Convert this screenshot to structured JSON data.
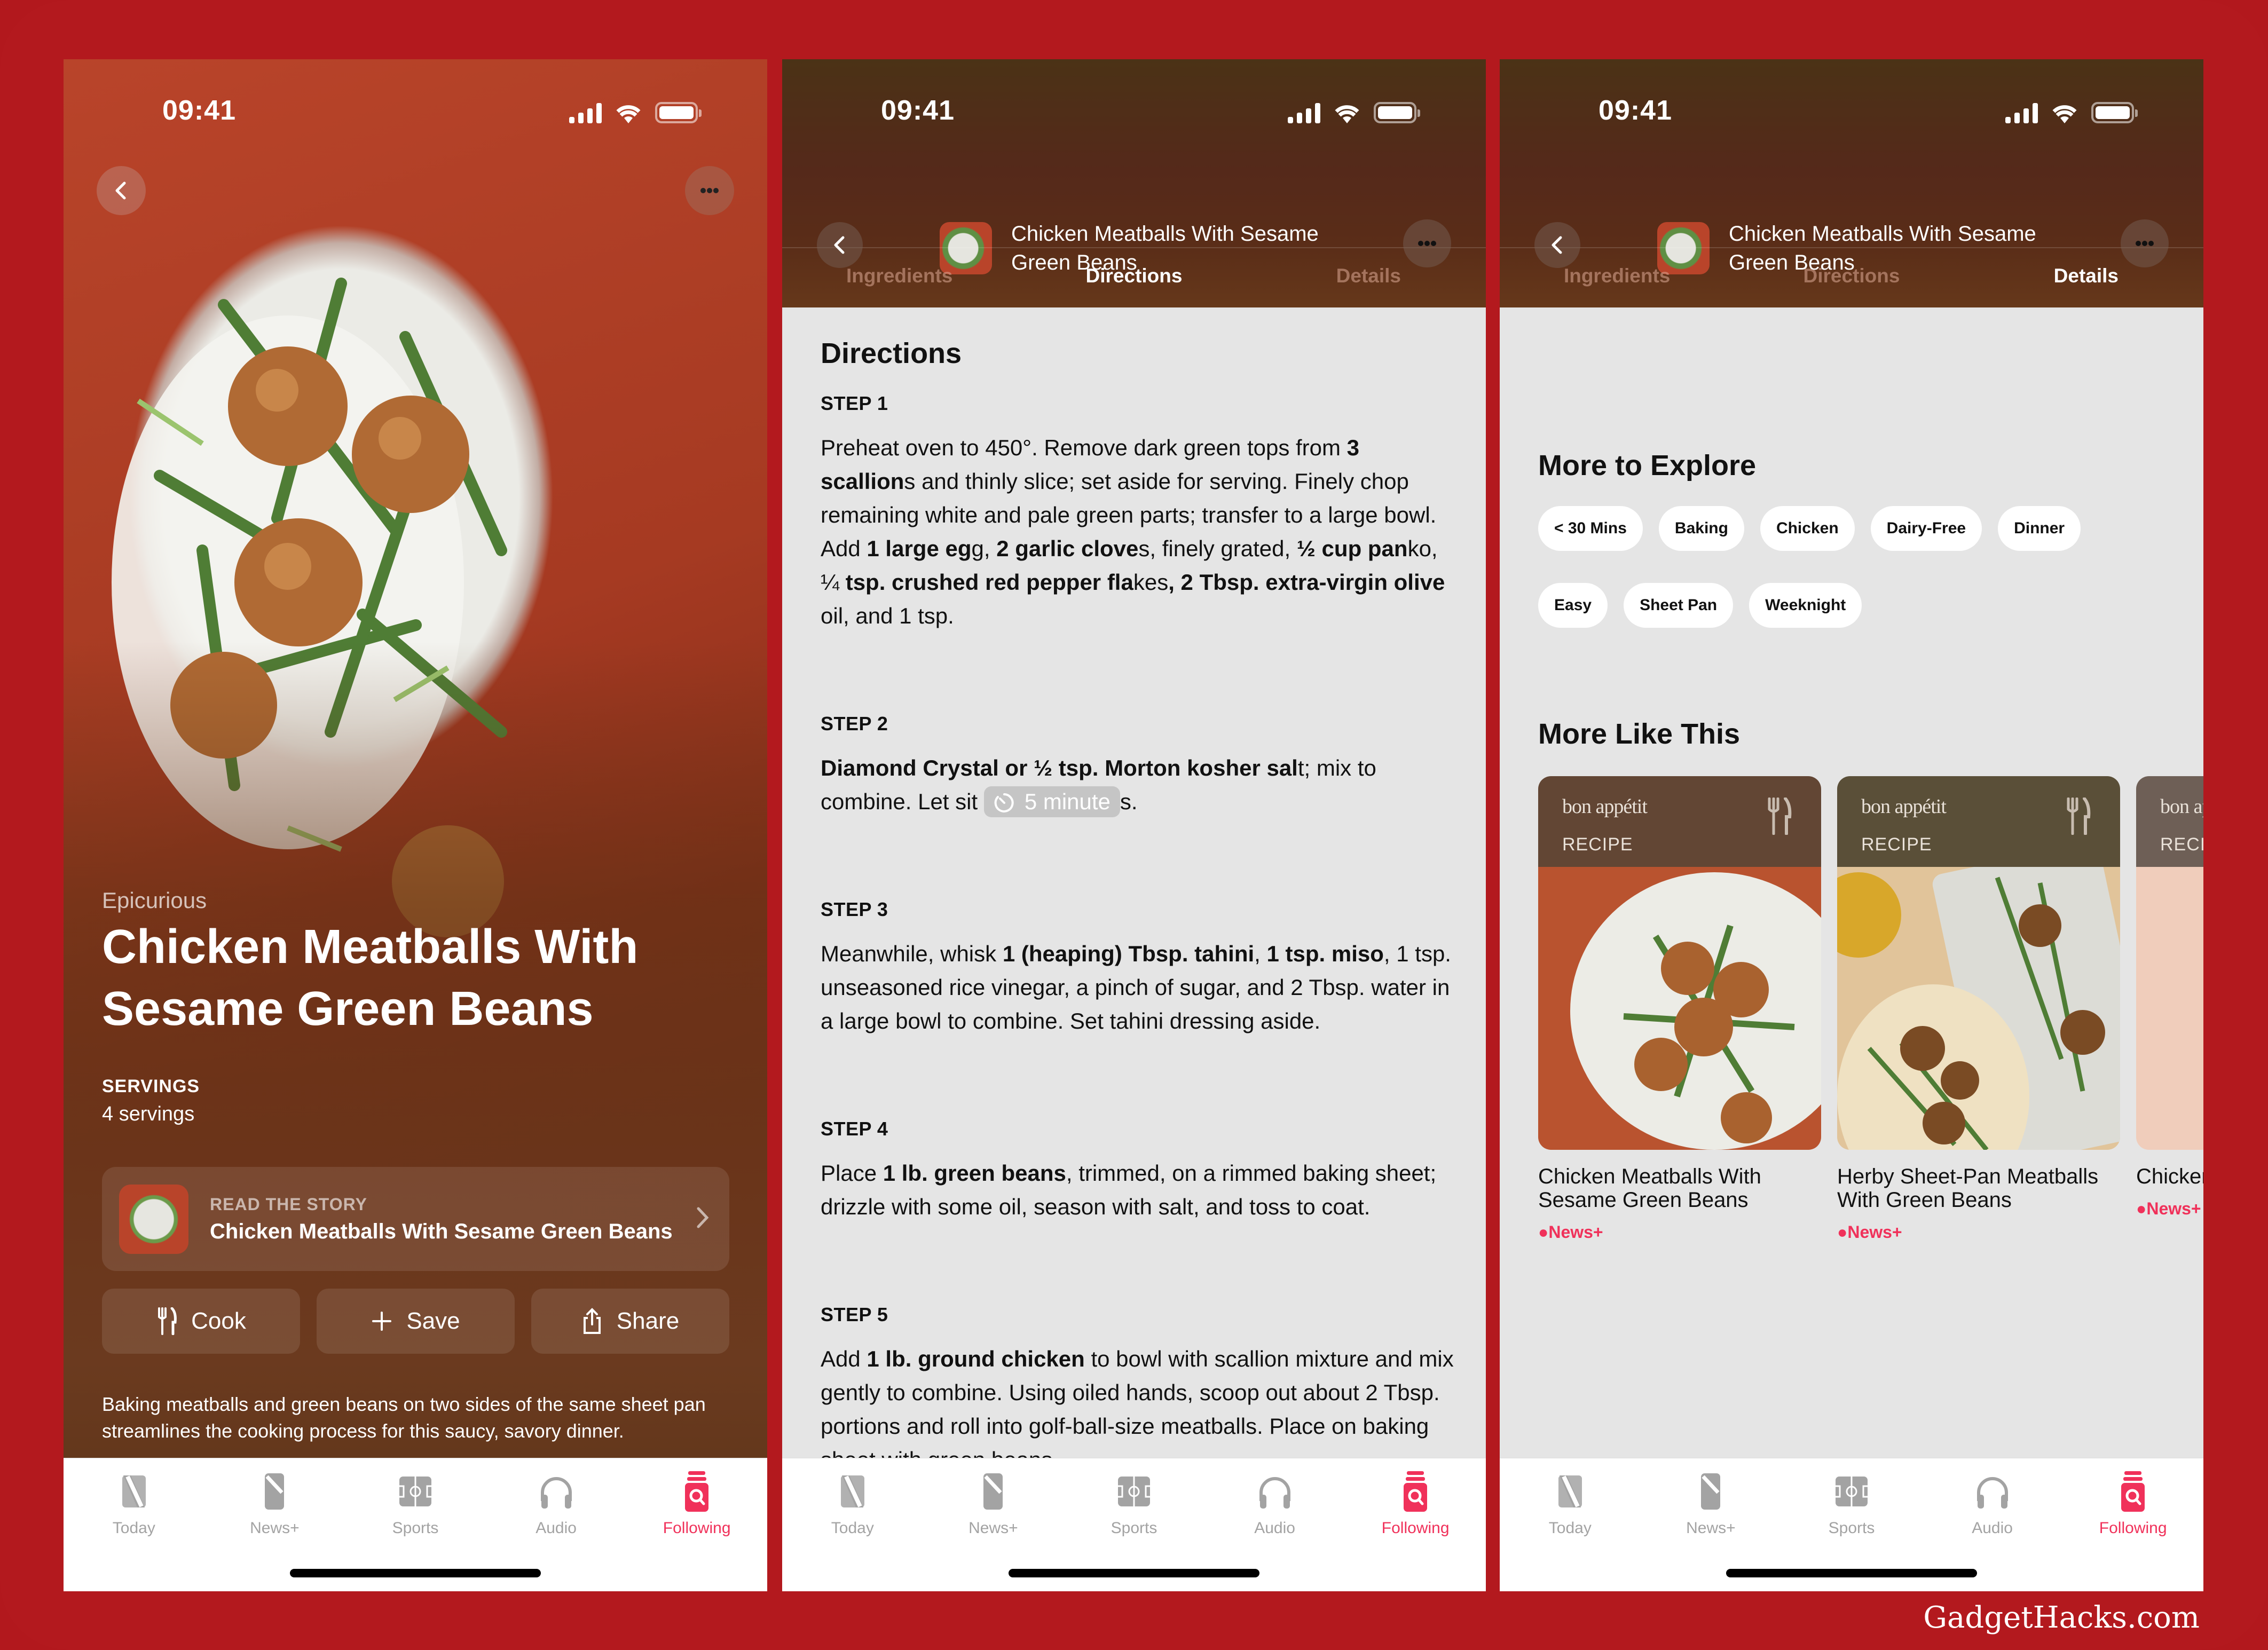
{
  "status_bar": {
    "time": "09:41"
  },
  "panel1": {
    "publisher": "Epicurious",
    "title": "Chicken Meatballs With Sesame Green Beans",
    "servings_label": "SERVINGS",
    "servings_value": "4 servings",
    "story": {
      "kicker": "READ THE STORY",
      "title": "Chicken Meatballs With Sesame Green Beans"
    },
    "actions": [
      {
        "label": "Cook",
        "icon": "fork-knife-icon"
      },
      {
        "label": "Save",
        "icon": "plus-icon"
      },
      {
        "label": "Share",
        "icon": "share-icon"
      }
    ],
    "description": "Baking meatballs and green beans on two sides of the same sheet pan streamlines the cooking process for this saucy, savory dinner."
  },
  "recipe_header": {
    "title": "Chicken Meatballs With Sesame Green Beans",
    "segments": [
      "Ingredients",
      "Directions",
      "Details"
    ]
  },
  "panel2": {
    "active_segment": "Directions",
    "heading": "Directions",
    "steps": [
      {
        "label": "STEP 1",
        "parts": [
          {
            "t": "Preheat oven to 450°. Remove dark green tops from "
          },
          {
            "t": "3 scallion",
            "b": true
          },
          {
            "t": "s and thinly slice; set aside for serving. Finely chop remaining white and pale green parts; transfer to a large bowl. Add "
          },
          {
            "t": "1 large eg",
            "b": true
          },
          {
            "t": "g, "
          },
          {
            "t": "2 garlic clove",
            "b": true
          },
          {
            "t": "s, finely grated, "
          },
          {
            "t": "½ cup pan",
            "b": true
          },
          {
            "t": "ko, ¼ "
          },
          {
            "t": "tsp. crushed red pepper fla",
            "b": true
          },
          {
            "t": "kes"
          },
          {
            "t": ", 2 Tbsp. extra-virgin olive",
            "b": true
          },
          {
            "t": " oil, and 1 tsp."
          }
        ]
      },
      {
        "label": "STEP 2",
        "parts": [
          {
            "t": "Diamond Crystal or ½ tsp. Morton kosher sal",
            "b": true
          },
          {
            "t": "t; mix to combine. Let sit "
          },
          {
            "t": "5 minute",
            "timer": true
          },
          {
            "t": "s."
          }
        ]
      },
      {
        "label": "STEP 3",
        "parts": [
          {
            "t": "Meanwhile, whisk "
          },
          {
            "t": "1 (heaping) Tbsp. tahini",
            "b": true
          },
          {
            "t": ", "
          },
          {
            "t": "1 tsp. miso",
            "b": true
          },
          {
            "t": ", 1 tsp. unseasoned rice vinegar, a pinch of sugar, and 2 Tbsp. water in a large bowl to combine. Set tahini dressing aside."
          }
        ]
      },
      {
        "label": "STEP 4",
        "parts": [
          {
            "t": "Place "
          },
          {
            "t": "1 lb. green beans",
            "b": true
          },
          {
            "t": ", trimmed, on a rimmed baking sheet; drizzle with some oil, season with salt, and toss to coat."
          }
        ]
      },
      {
        "label": "STEP 5",
        "parts": [
          {
            "t": "Add "
          },
          {
            "t": "1 lb. ground chicken",
            "b": true
          },
          {
            "t": " to bowl with scallion mixture and mix gently to combine. Using oiled hands, scoop out about 2 Tbsp. portions and roll into golf-ball-size meatballs. Place on baking sheet with green beans..."
          }
        ]
      }
    ]
  },
  "panel3": {
    "active_segment": "Details",
    "explore_heading": "More to Explore",
    "chips": [
      "< 30 Mins",
      "Baking",
      "Chicken",
      "Dairy-Free",
      "Dinner",
      "Easy",
      "Sheet Pan",
      "Weeknight"
    ],
    "more_heading": "More Like This",
    "cards": [
      {
        "brand": "bon appétit",
        "kind": "RECIPE",
        "title": "Chicken Meatballs With Sesame Green Beans",
        "badge": "News+",
        "band_color": "#624634"
      },
      {
        "brand": "bon appétit",
        "kind": "RECIPE",
        "title": "Herby Sheet-Pan Meatballs With Green Beans",
        "badge": "News+",
        "band_color": "#5a4f38"
      },
      {
        "brand": "bon appétit",
        "kind": "RECIPE",
        "title": "Chicken Green Broth",
        "badge": "News+",
        "band_color": "#6e5f56"
      }
    ]
  },
  "tabbar": {
    "items": [
      {
        "label": "Today",
        "icon": "news-today-icon"
      },
      {
        "label": "News+",
        "icon": "news-plus-icon"
      },
      {
        "label": "Sports",
        "icon": "sports-field-icon"
      },
      {
        "label": "Audio",
        "icon": "headphones-icon"
      },
      {
        "label": "Following",
        "icon": "following-search-icon",
        "active": true
      }
    ],
    "active_color": "#f0315a",
    "inactive_color": "#a3a3a3"
  },
  "watermark": "GadgetHacks.com",
  "colors": {
    "frame": "#b3191e",
    "accent": "#f0315a",
    "content_bg": "#e5e5e5"
  }
}
